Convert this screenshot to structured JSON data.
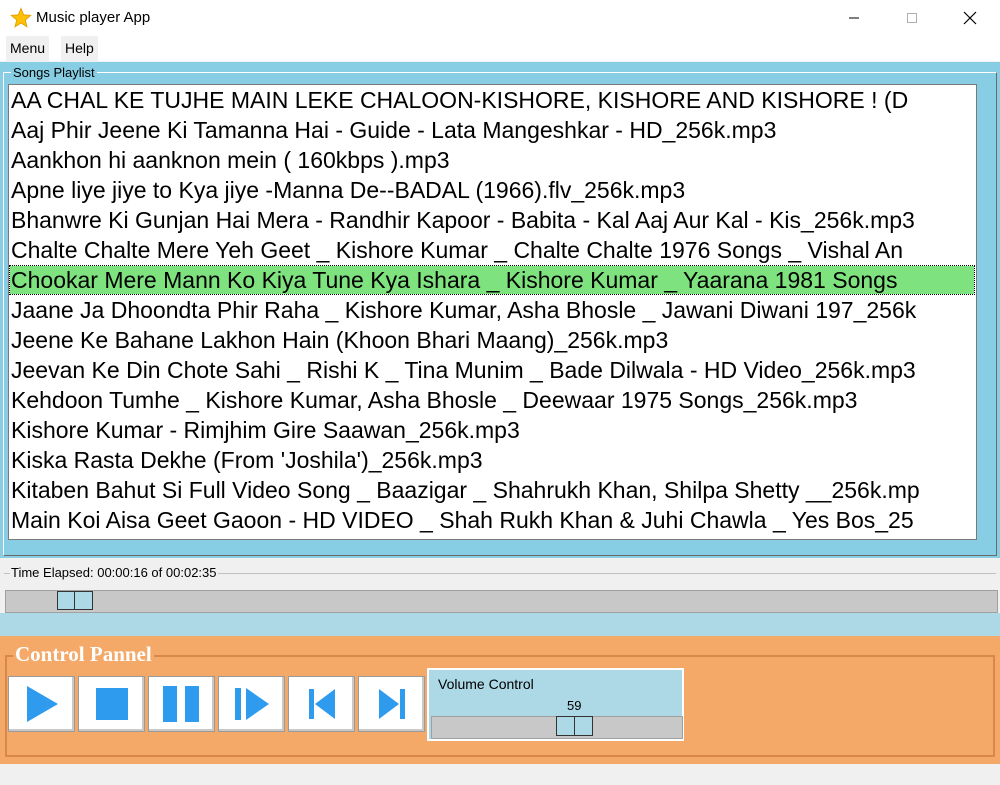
{
  "window": {
    "title": "Music player App",
    "app_icon": "star-icon",
    "controls": [
      "minimize-icon",
      "maximize-icon",
      "close-icon"
    ]
  },
  "menu": {
    "items": [
      "Menu",
      "Help"
    ]
  },
  "playlist": {
    "legend": "Songs Playlist",
    "selected_index": 6,
    "selected_color": "#7ee37e",
    "songs": [
      "AA CHAL KE  TUJHE MAIN LEKE CHALOON-KISHORE, KISHORE AND KISHORE ! (D",
      "Aaj Phir Jeene Ki Tamanna Hai - Guide - Lata Mangeshkar - HD_256k.mp3",
      "Aankhon hi aanknon mein ( 160kbps ).mp3",
      "Apne liye jiye to Kya jiye -Manna De--BADAL (1966).flv_256k.mp3",
      "Bhanwre Ki Gunjan Hai Mera - Randhir Kapoor - Babita - Kal Aaj Aur Kal - Kis_256k.mp3",
      "Chalte Chalte Mere Yeh Geet _ Kishore Kumar _ Chalte Chalte 1976 Songs _ Vishal An",
      "Chookar Mere Mann Ko Kiya Tune Kya Ishara _ Kishore Kumar _ Yaarana 1981 Songs",
      "Jaane Ja Dhoondta Phir Raha _ Kishore Kumar, Asha Bhosle _ Jawani Diwani 197_256k",
      "Jeene Ke Bahane Lakhon Hain (Khoon Bhari Maang)_256k.mp3",
      "Jeevan Ke Din Chote Sahi _ Rishi K _ Tina Munim _ Bade Dilwala - HD Video_256k.mp3",
      "Kehdoon Tumhe _ Kishore Kumar, Asha Bhosle _ Deewaar 1975 Songs_256k.mp3",
      "Kishore Kumar - Rimjhim Gire Saawan_256k.mp3",
      "Kiska Rasta Dekhe (From 'Joshila')_256k.mp3",
      "Kitaben Bahut Si Full Video Song _ Baazigar _ Shahrukh Khan, Shilpa Shetty __256k.mp",
      "Main Koi Aisa Geet Gaoon - HD VIDEO _ Shah Rukh Khan & Juhi Chawla _ Yes Bos_25"
    ]
  },
  "time": {
    "label": "Time Elapsed: 00:00:16 of 00:02:35",
    "progress_fraction": 0.103
  },
  "control_panel": {
    "legend": "Control Pannel",
    "buttons": [
      {
        "name": "play-button",
        "icon": "play-icon"
      },
      {
        "name": "stop-button",
        "icon": "stop-icon"
      },
      {
        "name": "pause-button",
        "icon": "pause-icon"
      },
      {
        "name": "resume-button",
        "icon": "step-play-icon"
      },
      {
        "name": "previous-button",
        "icon": "skip-previous-icon"
      },
      {
        "name": "next-button",
        "icon": "skip-next-icon"
      }
    ],
    "volume": {
      "title": "Volume Control",
      "value": "59"
    }
  },
  "colors": {
    "playlist_bg": "#87cee4",
    "accent_blue": "#2e9bef",
    "control_bg": "#f4a969",
    "slider_thumb": "#add8e6"
  }
}
